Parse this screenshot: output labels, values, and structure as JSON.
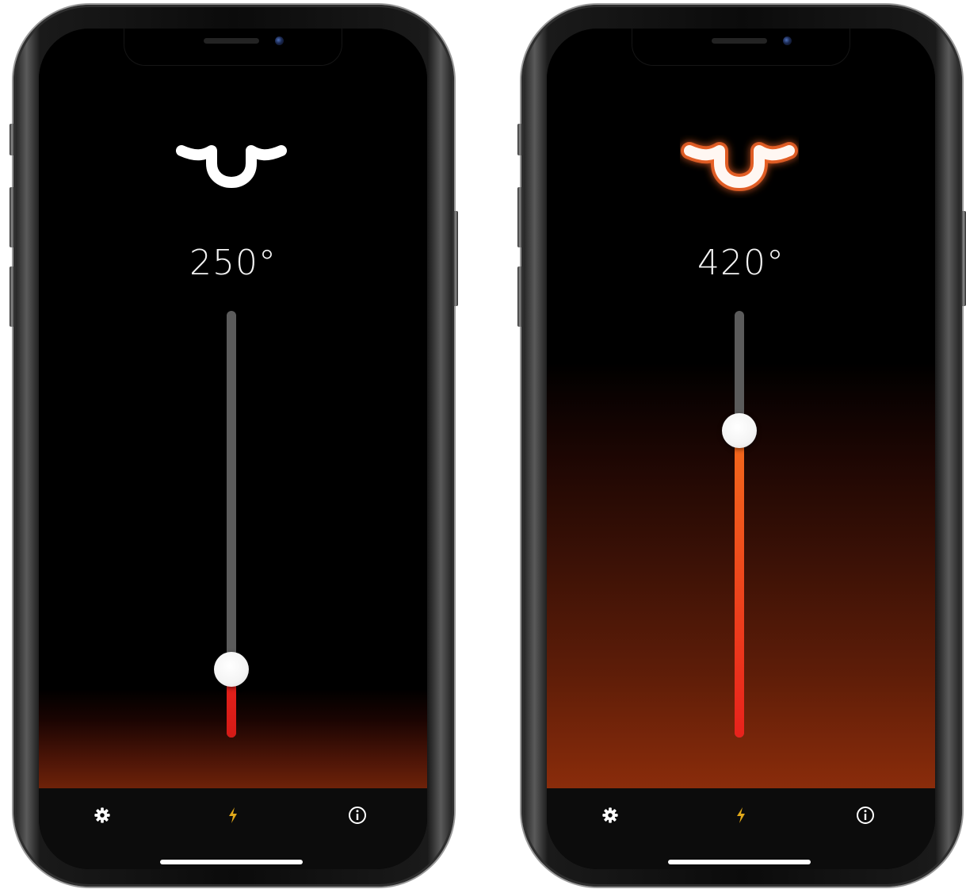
{
  "screens": [
    {
      "temperature": "250°",
      "slider_level": 0.16,
      "fill_color_top": "#e8221c",
      "fill_color_bottom": "#d41a16",
      "icon_glow": false,
      "tabs": [
        {
          "icon": "gear-icon"
        },
        {
          "icon": "lightning-icon"
        },
        {
          "icon": "info-icon"
        }
      ]
    },
    {
      "temperature": "420°",
      "slider_level": 0.72,
      "fill_color_top": "#f36a1c",
      "fill_color_bottom": "#e8221c",
      "icon_glow": true,
      "tabs": [
        {
          "icon": "gear-icon"
        },
        {
          "icon": "lightning-icon"
        },
        {
          "icon": "info-icon"
        }
      ]
    }
  ],
  "colors": {
    "accent_lightning": "#e0a81a",
    "track": "#5b5b5b",
    "tab_icon": "#ffffff"
  }
}
